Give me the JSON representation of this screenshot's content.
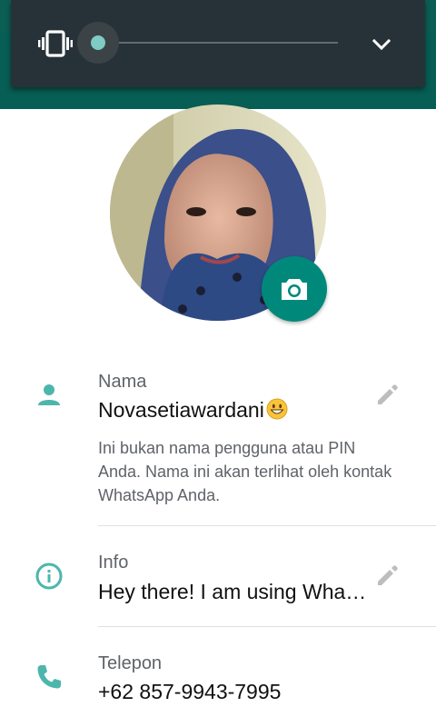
{
  "volume_panel": {
    "level": 0,
    "mode_icon": "vibrate-icon",
    "expand_icon": "chevron-down-icon"
  },
  "profile": {
    "avatar_icon": "avatar-photo",
    "camera_icon": "camera-icon"
  },
  "name_row": {
    "label": "Nama",
    "value": "Novasetiawardani",
    "value_emoji": "grinning-face-emoji",
    "hint": "Ini bukan nama pengguna atau PIN Anda. Nama ini akan terlihat oleh kontak WhatsApp Anda.",
    "icon": "person-icon",
    "edit_icon": "pencil-icon"
  },
  "info_row": {
    "label": "Info",
    "value": "Hey there! I am using Wha…",
    "icon": "info-icon",
    "edit_icon": "pencil-icon"
  },
  "phone_row": {
    "label": "Telepon",
    "value": "+62 857-9943-7995",
    "icon": "phone-icon"
  },
  "colors": {
    "primary": "#075e54",
    "accent": "#00897b",
    "icon": "#4db6ac",
    "panel": "#263238"
  }
}
